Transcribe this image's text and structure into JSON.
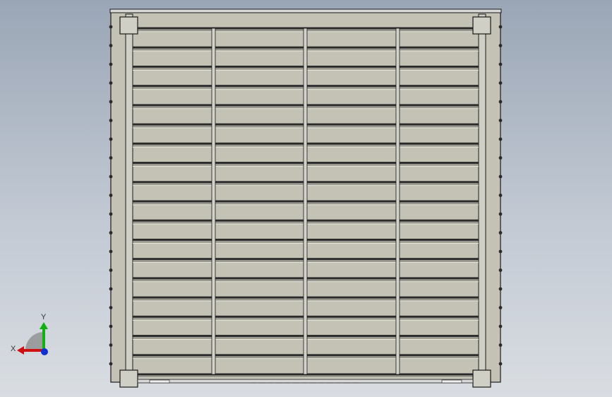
{
  "viewport": {
    "background_top": "#9aa6b6",
    "background_bottom": "#d9dde2"
  },
  "model": {
    "name": "louvered-panel",
    "fill_color": "#c3c2b5",
    "line_color": "#1a1a1a",
    "louver_rows": 18,
    "vertical_dividers": 3
  },
  "triad": {
    "x_label": "X",
    "y_label": "Y",
    "x_axis_color": "#d01010",
    "y_axis_color": "#10b010",
    "z_axis_color": "#1030d0"
  }
}
